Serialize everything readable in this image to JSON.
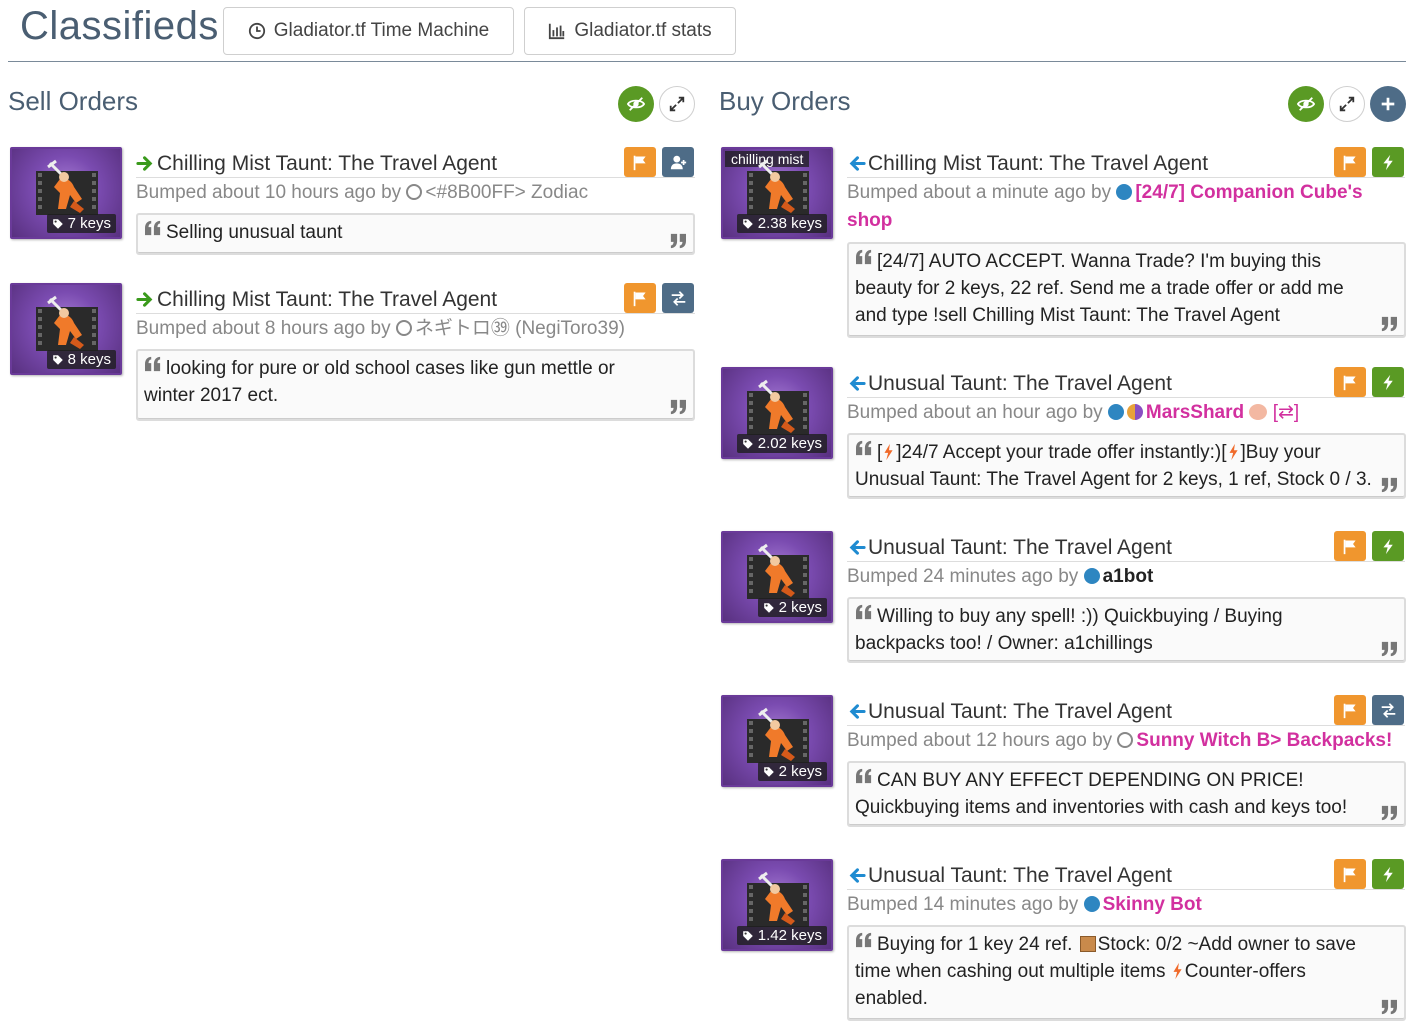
{
  "header": {
    "title": "Classifieds",
    "time_machine_label": "Gladiator.tf Time Machine",
    "stats_label": "Gladiator.tf stats"
  },
  "sell": {
    "title": "Sell Orders",
    "listings": [
      {
        "item": "Chilling Mist Taunt: The Travel Agent",
        "price": "7 keys",
        "bumped": "Bumped about 10 hours ago by",
        "user": "<#8B00FF> Zodiac",
        "message": "Selling unusual taunt"
      },
      {
        "item": "Chilling Mist Taunt: The Travel Agent",
        "price": "8 keys",
        "bumped": "Bumped about 8 hours ago by",
        "user": "ネギトロ㊴ (NegiToro39)",
        "message": "looking for pure or old school cases like gun mettle or winter 2017 ect."
      }
    ]
  },
  "buy": {
    "title": "Buy Orders",
    "listings": [
      {
        "item": "Chilling Mist Taunt: The Travel Agent",
        "note": "chilling mist",
        "price": "2.38 keys",
        "bumped": "Bumped about a minute ago by",
        "user_line1": "[24/7] Companion Cube's",
        "user_line2": "shop",
        "message": "[24/7] AUTO ACCEPT. Wanna Trade? I'm buying this beauty for 2 keys, 22 ref. Send me a trade offer or add me and type !sell Chilling Mist Taunt: The Travel Agent"
      },
      {
        "item": "Unusual Taunt: The Travel Agent",
        "price": "2.02 keys",
        "bumped": "Bumped about an hour ago by",
        "user": "MarsShard",
        "user_suffix": "[⇄]",
        "message_a": "[",
        "message_b": "]24/7 Accept your trade offer instantly:)[",
        "message_c": "]Buy your Unusual Taunt: The Travel Agent for 2 keys, 1 ref, Stock 0 / 3."
      },
      {
        "item": "Unusual Taunt: The Travel Agent",
        "price": "2 keys",
        "bumped": "Bumped 24 minutes ago by",
        "user": "a1bot",
        "message": "Willing to buy any spell! :)) Quickbuying / Buying backpacks too! / Owner: a1chillings"
      },
      {
        "item": "Unusual Taunt: The Travel Agent",
        "price": "2 keys",
        "bumped": "Bumped about 12 hours ago by",
        "user": "Sunny Witch B> Backpacks!",
        "message": "CAN BUY ANY EFFECT DEPENDING ON PRICE! Quickbuying items and inventories with cash and keys too!"
      },
      {
        "item": "Unusual Taunt: The Travel Agent",
        "price": "1.42 keys",
        "bumped": "Bumped 14 minutes ago by",
        "user": "Skinny Bot",
        "message_a": "Buying for 1 key 24 ref.",
        "message_b": "Stock: 0/2 ~Add owner to save time when cashing out multiple items",
        "message_c": "Counter-offers enabled."
      }
    ]
  },
  "colors": {
    "heading": "#4a5e72",
    "green": "#5a9a24",
    "orange": "#f0962e",
    "slate": "#4e6c87",
    "pink_user": "#d2309f",
    "thumb_purple": "#7a4bb0"
  },
  "icons": [
    "clock-icon",
    "bar-chart-icon",
    "eye-slash-icon",
    "expand-icon",
    "plus-icon",
    "arrow-right-icon",
    "arrow-left-icon",
    "flag-icon",
    "add-friend-icon",
    "exchange-icon",
    "bolt-icon",
    "tag-icon",
    "quote-open-icon",
    "quote-close-icon",
    "box-icon"
  ]
}
